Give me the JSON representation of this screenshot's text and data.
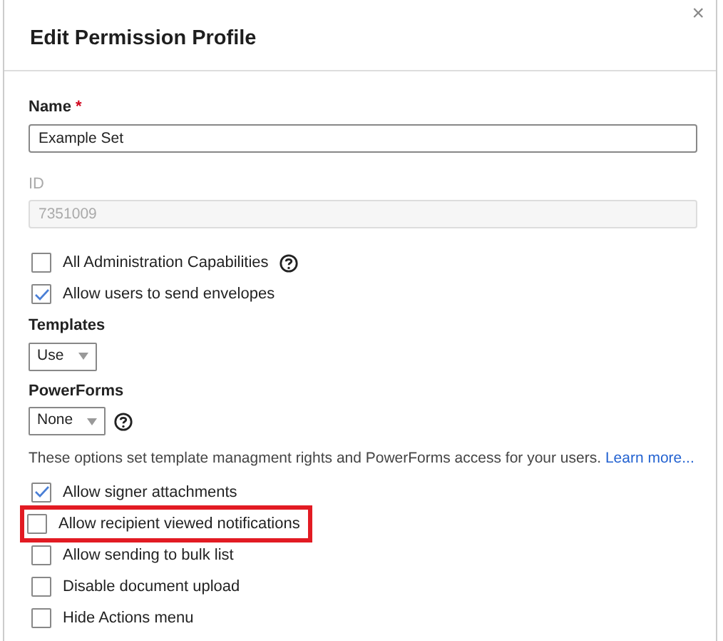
{
  "dialog": {
    "title": "Edit Permission Profile",
    "close": "×"
  },
  "name_field": {
    "label": "Name",
    "required": "*",
    "value": "Example Set",
    "disabled": false
  },
  "id_field": {
    "label": "ID",
    "value": "7351009",
    "disabled": true
  },
  "capabilities": [
    {
      "label": "All Administration Capabilities",
      "checked": false,
      "help": true
    },
    {
      "label": "Allow users to send envelopes",
      "checked": true,
      "help": false
    }
  ],
  "selects": [
    {
      "label": "Templates",
      "value": "Use",
      "help": false
    },
    {
      "label": "PowerForms",
      "value": "None",
      "help": true
    }
  ],
  "note": {
    "text": "These options set template managment rights and PowerForms access for your users.",
    "link": "Learn more..."
  },
  "options": [
    {
      "label": "Allow signer attachments",
      "checked": true,
      "highlighted": false
    },
    {
      "label": "Allow recipient viewed notifications",
      "checked": false,
      "highlighted": true
    },
    {
      "label": "Allow sending to bulk list",
      "checked": false,
      "highlighted": false
    },
    {
      "label": "Disable document upload",
      "checked": false,
      "highlighted": false
    },
    {
      "label": "Hide Actions menu",
      "checked": false,
      "highlighted": false
    }
  ]
}
